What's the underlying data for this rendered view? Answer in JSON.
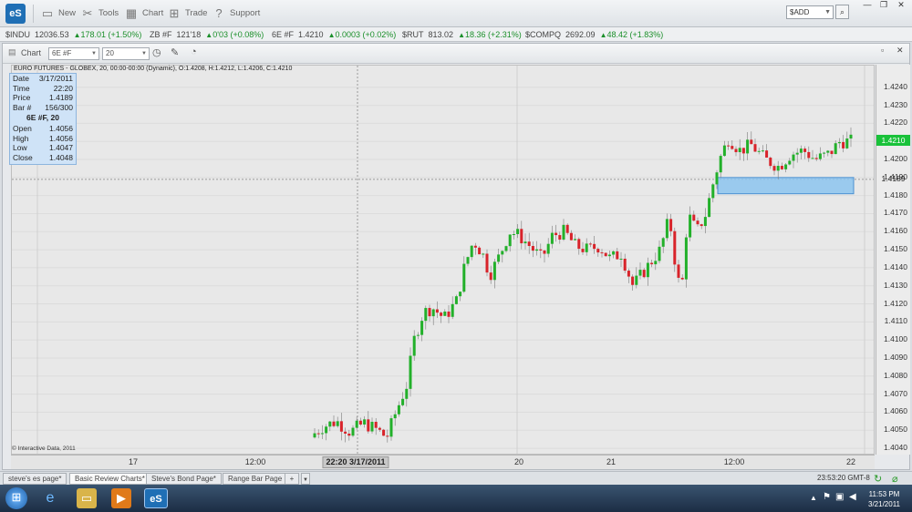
{
  "toolbar": {
    "logo": "eS",
    "buttons": [
      {
        "label": "New",
        "icon": "new-window-icon"
      },
      {
        "label": "Tools",
        "icon": "tools-icon"
      },
      {
        "label": "Chart",
        "icon": "chart-icon"
      },
      {
        "label": "Trade",
        "icon": "trade-icon"
      },
      {
        "label": "Support",
        "icon": "help-icon"
      }
    ],
    "symbol_input": "$ADD"
  },
  "ticker": [
    {
      "symbol": "$INDU",
      "price": "12036.53",
      "change": "178.01 (+1.50%)"
    },
    {
      "symbol": "ZB #F",
      "price": "121'18",
      "change": "0'03 (+0.08%)"
    },
    {
      "symbol": "6E #F",
      "price": "1.4210",
      "change": "0.0003 (+0.02%)"
    },
    {
      "symbol": "$RUT",
      "price": "813.02",
      "change": "18.36 (+2.31%)"
    },
    {
      "symbol": "$COMPQ",
      "price": "2692.09",
      "change": "48.42 (+1.83%)"
    }
  ],
  "chart_window": {
    "label": "Chart",
    "symbol": "6E #F",
    "interval": "20",
    "title": "EURO FUTURES - GLOBEX, 20, 00:00-00:00 (Dynamic), O:1.4208, H:1.4212, L:1.4206, C:1.4210",
    "copyright": "© Interactive Data, 2011"
  },
  "infobox": {
    "rows": [
      {
        "k": "Date",
        "v": "3/17/2011"
      },
      {
        "k": "Time",
        "v": "22:20"
      },
      {
        "k": "Price",
        "v": "1.4189"
      },
      {
        "k": "Bar #",
        "v": "156/300"
      }
    ],
    "header": "6E #F, 20",
    "ohlc": [
      {
        "k": "Open",
        "v": "1.4056"
      },
      {
        "k": "High",
        "v": "1.4056"
      },
      {
        "k": "Low",
        "v": "1.4047"
      },
      {
        "k": "Close",
        "v": "1.4048"
      }
    ]
  },
  "chart_data": {
    "type": "candlestick",
    "ylim": [
      1.4036,
      1.4252
    ],
    "yticks": [
      "1.4240",
      "1.4230",
      "1.4220",
      "1.4210",
      "1.4200",
      "1.4190",
      "1.4180",
      "1.4170",
      "1.4160",
      "1.4150",
      "1.4140",
      "1.4130",
      "1.4120",
      "1.4110",
      "1.4100",
      "1.4090",
      "1.4080",
      "1.4070",
      "1.4060",
      "1.4050",
      "1.4040"
    ],
    "xticks": [
      "17",
      "12:00",
      "20",
      "21",
      "12:00",
      "22"
    ],
    "crosshair_time": "22:20 3/17/2011",
    "crosshair_price": "1.4189",
    "last_price": "1.4210",
    "highlight_zone": [
      1.4181,
      1.419
    ],
    "colors": {
      "up": "#22b02a",
      "down": "#d8232a",
      "zone": "#8cc4ee"
    }
  },
  "tabs": [
    "steve's es page*",
    "Basic Review Charts*",
    "Steve's Bond Page*",
    "Range Bar Page"
  ],
  "status_clock": "23:53:20  GMT-8",
  "taskbar": {
    "time": "11:53 PM",
    "date": "3/21/2011"
  }
}
